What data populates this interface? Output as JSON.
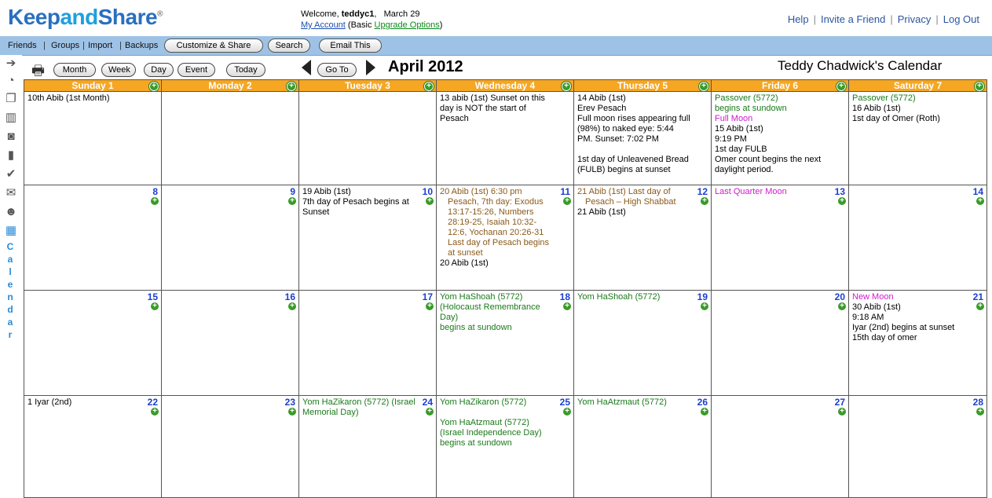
{
  "header": {
    "logo_keep": "Keep",
    "logo_and": "and",
    "logo_share": "Share",
    "logo_reg": "®",
    "welcome_prefix": "Welcome,",
    "username": "teddyc1",
    "welcome_date": "March 29",
    "my_account": "My Account",
    "plan_text": "(Basic",
    "upgrade": "Upgrade Options",
    "plan_close": ")",
    "links": [
      "Help",
      "Invite a Friend",
      "Privacy",
      "Log Out"
    ]
  },
  "nav": {
    "friends": "Friends",
    "groups": "Groups",
    "import": "Import",
    "backups": "Backups",
    "customize": "Customize & Share",
    "search": "Search",
    "email": "Email This"
  },
  "sidebar": {
    "label_letters": [
      "C",
      "a",
      "l",
      "e",
      "n",
      "d",
      "a",
      "r"
    ]
  },
  "toolbar": {
    "month": "Month",
    "week": "Week",
    "day": "Day",
    "event": "Event",
    "today": "Today",
    "goto": "Go To",
    "month_title": "April 2012",
    "calendar_title": "Teddy Chadwick's Calendar"
  },
  "calendar": {
    "weekdays": [
      "Sunday 1",
      "Monday 2",
      "Tuesday 3",
      "Wednesday 4",
      "Thursday 5",
      "Friday 6",
      "Saturday 7"
    ],
    "first_row": [
      [
        "10th Abib (1st Month)"
      ],
      [],
      [],
      [
        "13 abib (1st) Sunset on this day is NOT the start of Pesach"
      ],
      [
        "14 Abib (1st)",
        "Erev Pesach",
        "Full moon rises appearing full (98%) to naked eye: 5:44 PM. Sunset: 7:02 PM",
        "",
        "1st day of Unleavened Bread (FULB) begins at sunset"
      ],
      [
        "Passover (5772)",
        "begins at sundown",
        "Full Moon",
        "15 Abib (1st)",
        "9:19 PM",
        "1st day FULB",
        "Omer count begins the next daylight period."
      ],
      [
        "Passover (5772)",
        "16 Abib (1st)",
        "1st day of Omer (Roth)"
      ]
    ],
    "weeks": [
      {
        "days": [
          "8",
          "9",
          "10",
          "11",
          "12",
          "13",
          "14"
        ],
        "events": [
          [],
          [],
          [
            "19 Abib (1st)",
            "7th day of Pesach begins at Sunset"
          ],
          [
            "20 Abib (1st) 6:30 pm",
            "Pesach, 7th day: Exodus 13:17-15:26, Numbers 28:19-25, Isaiah 10:32-12:6, Yochanan 20:26-31 Last day of Pesach begins at sunset",
            "20 Abib (1st)"
          ],
          [
            "21 Abib (1st) Last day of",
            "Pesach – High Shabbat",
            "21 Abib (1st)"
          ],
          [
            "Last Quarter Moon"
          ],
          []
        ]
      },
      {
        "days": [
          "15",
          "16",
          "17",
          "18",
          "19",
          "20",
          "21"
        ],
        "events": [
          [],
          [],
          [],
          [
            "Yom HaShoah (5772) (Holocaust Remembrance Day)",
            "begins at sundown"
          ],
          [
            "Yom HaShoah (5772)"
          ],
          [],
          [
            "New Moon",
            "30 Abib (1st)",
            "9:18 AM",
            "Iyar (2nd) begins at sunset",
            "15th day of omer"
          ]
        ]
      },
      {
        "days": [
          "22",
          "23",
          "24",
          "25",
          "26",
          "27",
          "28"
        ],
        "events": [
          [
            "1 Iyar (2nd)"
          ],
          [],
          [
            "Yom HaZikaron (5772) (Israel Memorial Day)"
          ],
          [
            "Yom HaZikaron (5772)",
            "",
            "Yom HaAtzmaut (5772) (Israel Independence Day)",
            "begins at sundown"
          ],
          [
            "Yom HaAtzmaut (5772)"
          ],
          [],
          []
        ]
      }
    ]
  },
  "colors": {
    "header_bg": "#f5a623",
    "nav_bg": "#9ec2e5",
    "day_number": "#1a3fd0",
    "holiday_green": "#1a7a1a",
    "torah_brown": "#8a5a1a",
    "moon_magenta": "#d01ad0"
  }
}
